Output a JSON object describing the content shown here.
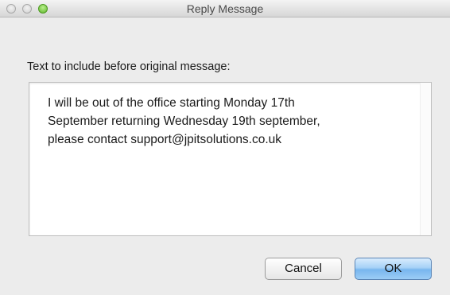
{
  "window": {
    "title": "Reply Message"
  },
  "form": {
    "prompt_label": "Text to include before original message:",
    "message_text": "I will be out of the office starting Monday 17th\nSeptember returning Wednesday 19th september,\nplease contact support@jpitsolutions.co.uk"
  },
  "buttons": {
    "cancel_label": "Cancel",
    "ok_label": "OK"
  },
  "colors": {
    "window_bg": "#ececec",
    "default_button_blue": "#78b6ee",
    "zoom_green": "#5fb52c"
  }
}
